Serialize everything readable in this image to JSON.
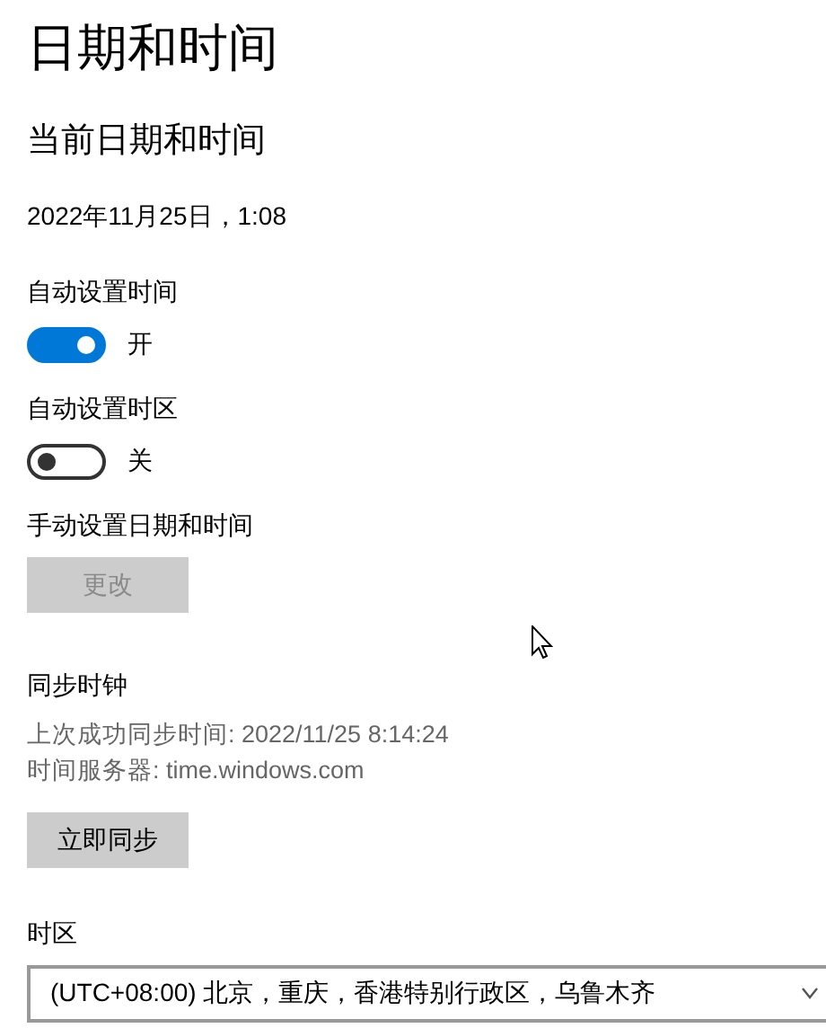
{
  "title": "日期和时间",
  "subtitle": "当前日期和时间",
  "current_datetime": "2022年11月25日，1:08",
  "toggles": [
    {
      "label": "自动设置时间",
      "on": true,
      "state_text": "开"
    },
    {
      "label": "自动设置时区",
      "on": false,
      "state_text": "关"
    }
  ],
  "manual": {
    "label": "手动设置日期和时间",
    "button": {
      "label": "更改",
      "disabled": true
    }
  },
  "sync": {
    "heading": "同步时钟",
    "last_sync": "上次成功同步时间: 2022/11/25 8:14:24",
    "server": "时间服务器: time.windows.com",
    "button": {
      "label": "立即同步",
      "disabled": false
    }
  },
  "timezone": {
    "label": "时区",
    "value": "(UTC+08:00) 北京，重庆，香港特别行政区，乌鲁木齐"
  }
}
